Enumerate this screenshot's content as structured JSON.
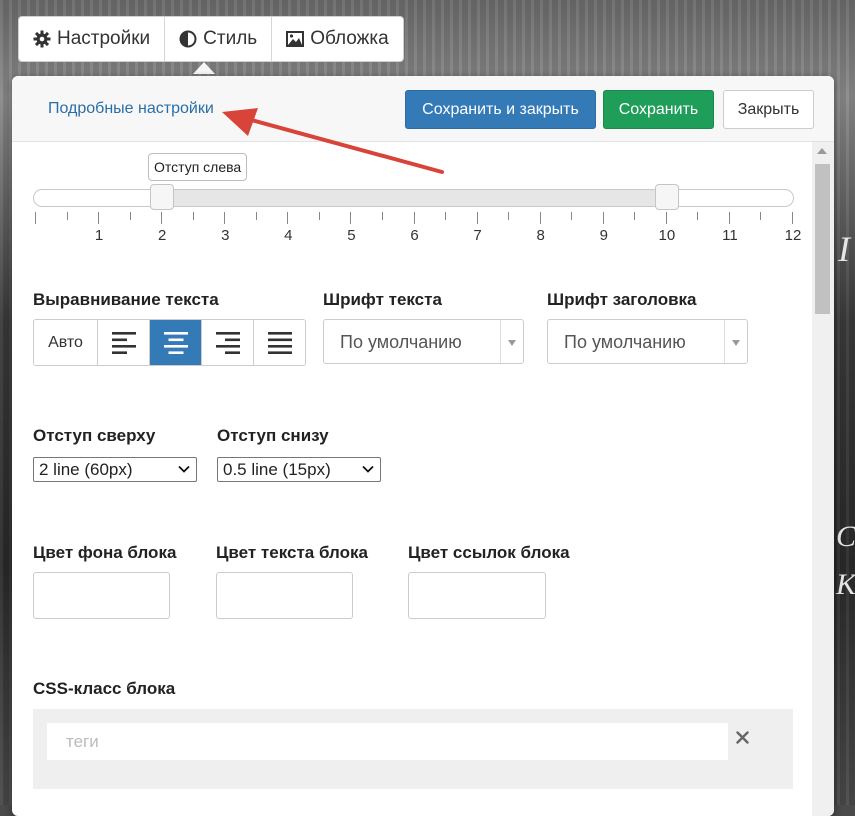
{
  "tabs": [
    {
      "label": "Настройки",
      "icon": "gear-icon"
    },
    {
      "label": "Стиль",
      "icon": "contrast-icon"
    },
    {
      "label": "Обложка",
      "icon": "image-icon"
    }
  ],
  "header": {
    "advanced_link": "Подробные настройки",
    "save_close": "Сохранить и закрыть",
    "save": "Сохранить",
    "close": "Закрыть"
  },
  "slider": {
    "tooltip": "Отступ слева",
    "min": 0,
    "max": 12,
    "value_left": 2,
    "value_right": 10,
    "ticks": [
      "1",
      "2",
      "3",
      "4",
      "5",
      "6",
      "7",
      "8",
      "9",
      "10",
      "11",
      "12"
    ]
  },
  "text_align": {
    "label": "Выравнивание текста",
    "auto": "Авто",
    "active": "center"
  },
  "font_text": {
    "label": "Шрифт текста",
    "value": "По умолчанию"
  },
  "font_heading": {
    "label": "Шрифт заголовка",
    "value": "По умолчанию"
  },
  "padding_top": {
    "label": "Отступ сверху",
    "value": "2 line (60px)"
  },
  "padding_bottom": {
    "label": "Отступ снизу",
    "value": "0.5 line (15px)"
  },
  "bg_color": {
    "label": "Цвет фона блока"
  },
  "text_color": {
    "label": "Цвет текста блока"
  },
  "link_color": {
    "label": "Цвет ссылок блока"
  },
  "css_class": {
    "label": "CSS-класс блока",
    "placeholder": "теги"
  },
  "colors": {
    "primary": "#337ab7",
    "success": "#1f9e5a",
    "link": "#2a6ea6",
    "arrow": "#d9443a"
  }
}
